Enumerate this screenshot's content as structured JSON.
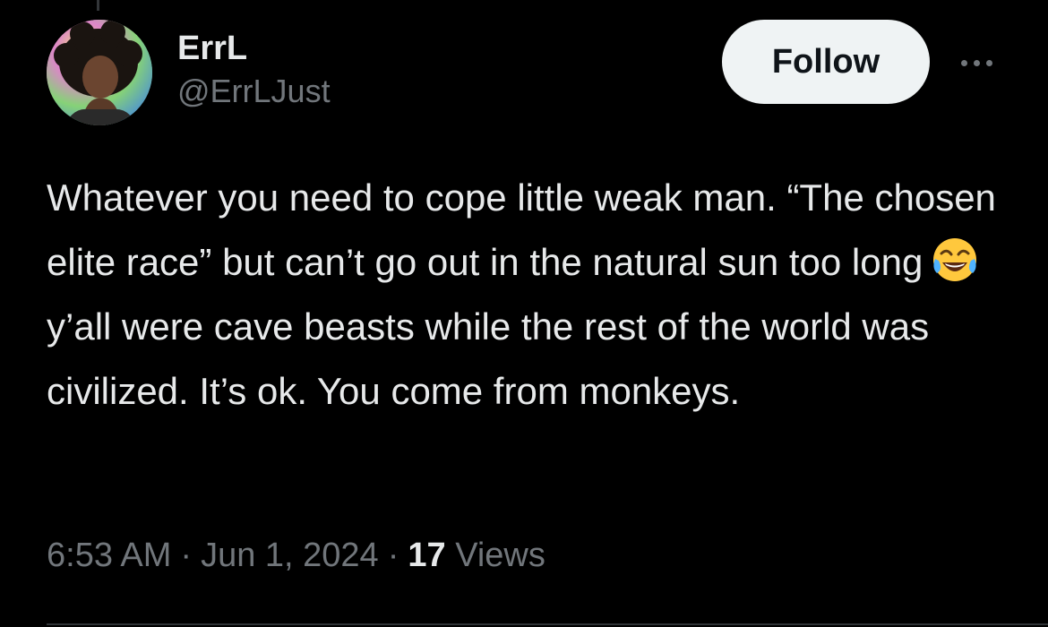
{
  "tweet": {
    "display_name": "ErrL",
    "handle": "@ErrLJust",
    "follow_label": "Follow",
    "text_before_emoji": "Whatever you need to cope little weak man. “The chosen elite race” but can’t go out in the natural sun too long",
    "emoji": "face-with-tears-of-joy",
    "text_after_emoji": "y’all were cave beasts while the rest of the world was civilized. It’s ok. You come from monkeys.",
    "time": "6:53 AM",
    "date": "Jun 1, 2024",
    "separator": "·",
    "views_count": "17",
    "views_label": "Views"
  },
  "icons": {
    "more": "more-horizontal-icon",
    "avatar": "profile-avatar"
  },
  "colors": {
    "background": "#000000",
    "primary_text": "#e7e9ea",
    "secondary_text": "#71767b",
    "follow_button_bg": "#eff3f4",
    "follow_button_text": "#0f1419"
  }
}
